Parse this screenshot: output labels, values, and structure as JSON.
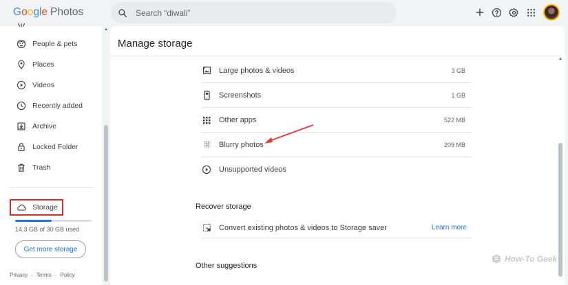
{
  "app": {
    "logo_letters": [
      "G",
      "o",
      "o",
      "g",
      "l",
      "e"
    ],
    "logo_colors": [
      "#4285f4",
      "#ea4335",
      "#fbbc04",
      "#4285f4",
      "#34a853",
      "#ea4335"
    ],
    "logo_suffix": "Photos"
  },
  "search": {
    "placeholder": "Search “diwali”"
  },
  "topbar_icons": [
    "add-icon",
    "help-icon",
    "settings-icon",
    "apps-icon",
    "avatar"
  ],
  "sidebar": {
    "items": [
      {
        "label": "People & pets",
        "icon": "face-icon"
      },
      {
        "label": "Places",
        "icon": "location-pin-icon"
      },
      {
        "label": "Videos",
        "icon": "play-circle-icon"
      },
      {
        "label": "Recently added",
        "icon": "clock-icon"
      },
      {
        "label": "Archive",
        "icon": "archive-icon"
      },
      {
        "label": "Locked Folder",
        "icon": "lock-icon"
      },
      {
        "label": "Trash",
        "icon": "trash-icon"
      }
    ],
    "storage_label": "Storage",
    "storage_used_text": "14.3 GB of 30 GB used",
    "storage_fraction": 0.477,
    "get_more_label": "Get more storage",
    "footer": {
      "privacy": "Privacy",
      "sep1": "·",
      "terms": "Terms",
      "sep2": "·",
      "policy": "Policy"
    }
  },
  "main": {
    "title": "Manage storage",
    "rows": [
      {
        "label": "Large photos & videos",
        "size": "3 GB",
        "icon": "large-photo-icon"
      },
      {
        "label": "Screenshots",
        "size": "1 GB",
        "icon": "phone-icon"
      },
      {
        "label": "Other apps",
        "size": "522 MB",
        "icon": "grid-dots-icon"
      },
      {
        "label": "Blurry photos",
        "size": "209 MB",
        "icon": "blur-icon"
      },
      {
        "label": "Unsupported videos",
        "size": "",
        "icon": "play-circle-icon"
      }
    ],
    "recover": {
      "title": "Recover storage",
      "label": "Convert existing photos & videos to Storage saver",
      "link": "Learn more"
    },
    "other_title": "Other suggestions"
  },
  "annotation": {
    "arrow_color": "#e53935"
  },
  "watermark": {
    "text": "How-To Geek"
  },
  "colors": {
    "accent": "#1a73e8",
    "highlight_box": "#d32f2f"
  }
}
